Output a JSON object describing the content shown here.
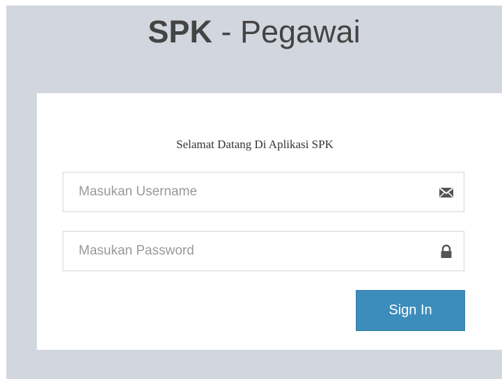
{
  "logo": {
    "bold": "SPK",
    "rest": " - Pegawai"
  },
  "login": {
    "message": "Selamat Datang Di Aplikasi SPK",
    "username": {
      "placeholder": "Masukan Username",
      "value": "",
      "icon": "envelope-icon"
    },
    "password": {
      "placeholder": "Masukan Password",
      "value": "",
      "icon": "lock-icon"
    },
    "submit_label": "Sign In"
  },
  "colors": {
    "page_background": "#d2d6de",
    "box_background": "#ffffff",
    "accent": "#3c8dbc",
    "logo_text": "#444444"
  }
}
